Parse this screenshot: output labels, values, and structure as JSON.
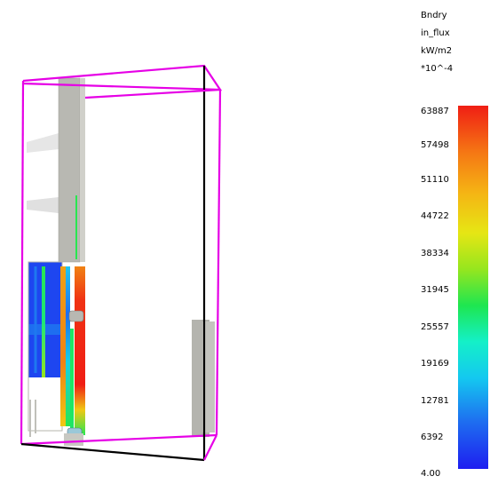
{
  "legend": {
    "header": [
      "Bndry",
      "in_flux",
      "kW/m2",
      "*10^-4"
    ],
    "ticks": [
      "63887",
      "57498",
      "51110",
      "44722",
      "38334",
      "31945",
      "25557",
      "19169",
      "12781",
      "6392",
      "4.00"
    ]
  },
  "colors": {
    "box_edge": "#e600e6",
    "box_edge_dark": "#000000",
    "panel_gray": "#b4b4ae",
    "flux_low": "#1e1ef0",
    "flux_high": "#f01e14"
  }
}
